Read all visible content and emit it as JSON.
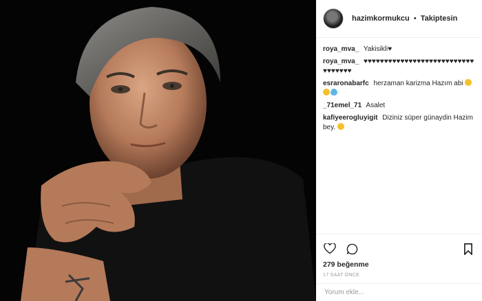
{
  "post": {
    "username": "hazimkormukcu",
    "separator": "•",
    "follow_label": "Takiptesin"
  },
  "comments": [
    {
      "user": "roya_mva_",
      "text": "Yakisikli♥"
    },
    {
      "user": "roya_mva_",
      "text": "♥♥♥♥♥♥♥♥♥♥♥♥♥♥♥♥♥♥♥♥♥♥♥♥♥♥♥♥♥♥♥♥♥♥"
    },
    {
      "user": "esraronabarfc",
      "text": "herzaman karizma Hazım abi"
    },
    {
      "user": "_71emel_71",
      "text": "Asalet"
    },
    {
      "user": "kafiyeerogluyigit",
      "text": "Diziniz süper günaydin Hazim bey."
    }
  ],
  "likes": "279 beğenme",
  "time_ago": "17 SAAT ÖNCE",
  "add_comment": {
    "placeholder": "Yorum ekle..."
  },
  "icons": [
    "heart-icon",
    "comment-icon",
    "bookmark-icon"
  ]
}
